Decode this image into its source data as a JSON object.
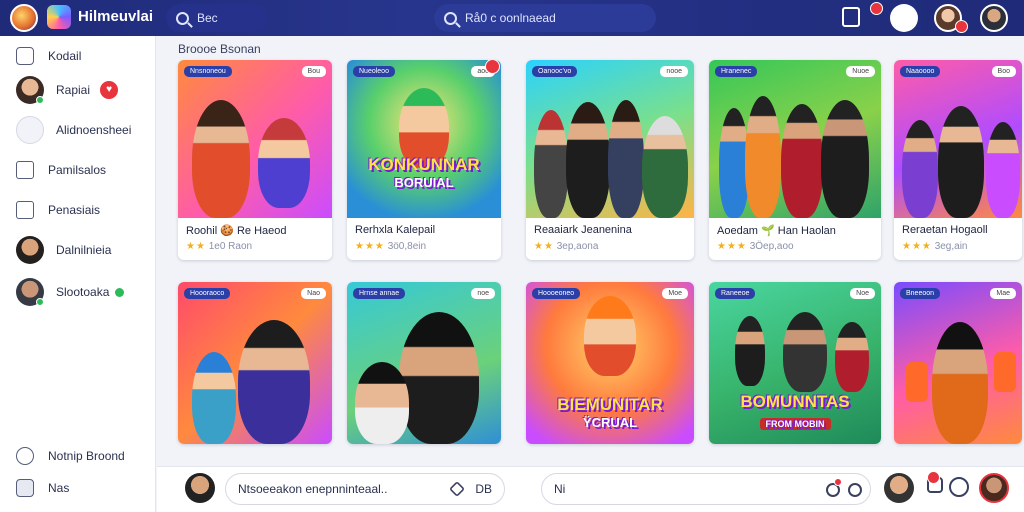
{
  "app": {
    "name": "Hilmeuvlai",
    "search_left": "Bec",
    "search_center": "Rå0 c oonlnaead",
    "accent": "#1f2a78"
  },
  "sidebar": {
    "items": [
      {
        "label": "Kodail"
      },
      {
        "label": "Rapiai"
      },
      {
        "label": "Alidnoensheei"
      },
      {
        "label": "Pamilsalos"
      },
      {
        "label": "Penasiais"
      },
      {
        "label": "Dalnilnieia"
      },
      {
        "label": "Slootoaka"
      }
    ],
    "footer": [
      {
        "label": "Notnip Broond"
      },
      {
        "label": "Nas"
      }
    ]
  },
  "section_title": "Broooe Bsonan",
  "cards": [
    {
      "title": "Roohil 🍪 Re Haeod",
      "tag": "Nnsnoneou",
      "tag2": "Bou",
      "meta": "1e0 Raon",
      "stars": "★★"
    },
    {
      "title": "Rerhxla Kalepail",
      "tag": "Nueoleoo",
      "tag2": "aoo",
      "meta": "3ö0,8ein",
      "stars": "★★★",
      "overlay": "KONKUNNAR",
      "overlay2": "BORUIAL"
    },
    {
      "title": "Reaaiark Jeanenina",
      "tag": "Oanooc'vo",
      "tag2": "nooe",
      "meta": "3ep,aona",
      "stars": "★★"
    },
    {
      "title": "Aoedam 🌱 Han Haolan",
      "tag": "Hranenec",
      "tag2": "Nuoe",
      "meta": "3Öep,aoo",
      "stars": "★★★"
    },
    {
      "title": "Reraetan Hogaoll",
      "tag": "Naaoooo",
      "tag2": "Boo",
      "meta": "3eg,ain",
      "stars": "★★★"
    },
    {
      "tag": "Hoooraoco",
      "tag2": "Nao"
    },
    {
      "tag": "Hrnse annae",
      "tag2": "noe"
    },
    {
      "tag": "Hoooeoneo",
      "tag2": "Moe",
      "overlay": "BIEMUNITAR",
      "overlay2": "ŸCRUAL"
    },
    {
      "tag": "Raneeoe",
      "tag2": "Noe",
      "overlay": "BOMUNNTAS",
      "overlay2": "FROM MOBIN"
    },
    {
      "tag": "Bneeoon",
      "tag2": "Mae"
    }
  ],
  "bottom": {
    "comment_placeholder": "Ntsoeeakon enepnninteaal..",
    "comment_icon_text": "DB",
    "reply_text": "Ni"
  }
}
